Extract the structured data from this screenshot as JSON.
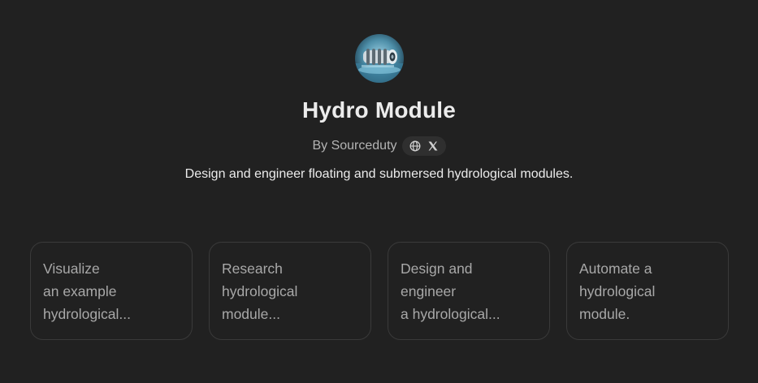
{
  "gpt": {
    "name": "Hydro Module",
    "byline": "By Sourceduty",
    "description": "Design and engineer floating and submersed hydrological modules.",
    "avatar_icon": "hydro-module-avatar",
    "links": [
      {
        "icon": "globe-icon"
      },
      {
        "icon": "x-logo-icon"
      }
    ]
  },
  "conversation_starters": [
    {
      "lines": [
        "Visualize",
        "an example",
        "hydrological..."
      ]
    },
    {
      "lines": [
        "Research",
        "hydrological",
        "module..."
      ]
    },
    {
      "lines": [
        "Design and",
        "engineer",
        "a hydrological..."
      ]
    },
    {
      "lines": [
        "Automate a",
        "hydrological",
        "module."
      ]
    }
  ],
  "colors": {
    "background": "#212121",
    "card_border": "#3a3a3a",
    "text_primary": "#ececec",
    "text_secondary": "#b4b4b4"
  }
}
